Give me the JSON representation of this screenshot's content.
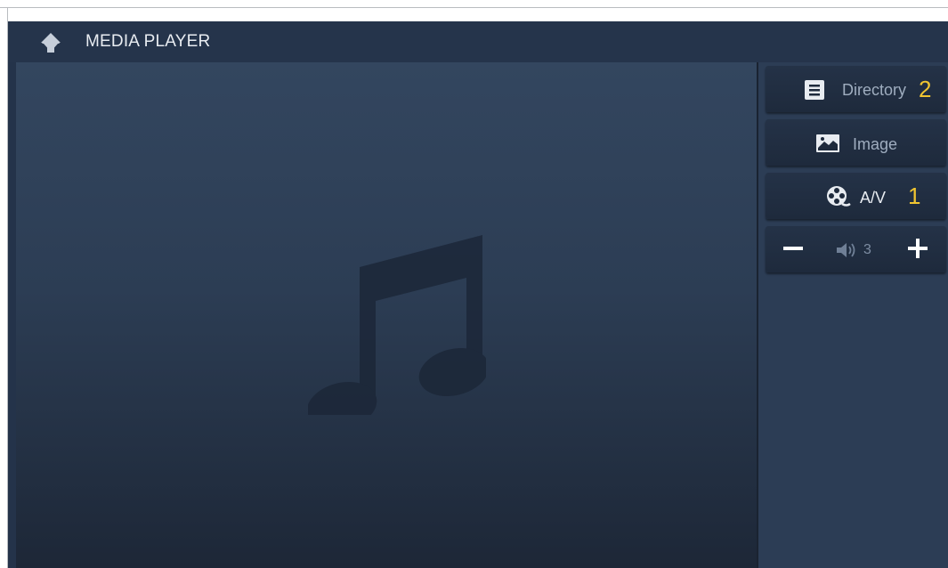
{
  "header": {
    "title": "MEDIA PLAYER",
    "back_icon": "back-arrow-icon"
  },
  "stage": {
    "placeholder_icon": "music-note-icon"
  },
  "sidebar": {
    "directory": {
      "label": "Directory",
      "badge": "2",
      "icon": "list-icon"
    },
    "image": {
      "label": "Image",
      "icon": "image-icon"
    },
    "av": {
      "label": "A/V",
      "badge": "1",
      "icon": "film-reel-icon"
    },
    "volume": {
      "level": "3",
      "icon": "speaker-icon",
      "minus_icon": "minus-icon",
      "plus_icon": "plus-icon"
    }
  },
  "colors": {
    "accent": "#f0c531",
    "background": "#24334a",
    "button": "#202d40",
    "text_muted": "#9fadbf"
  }
}
